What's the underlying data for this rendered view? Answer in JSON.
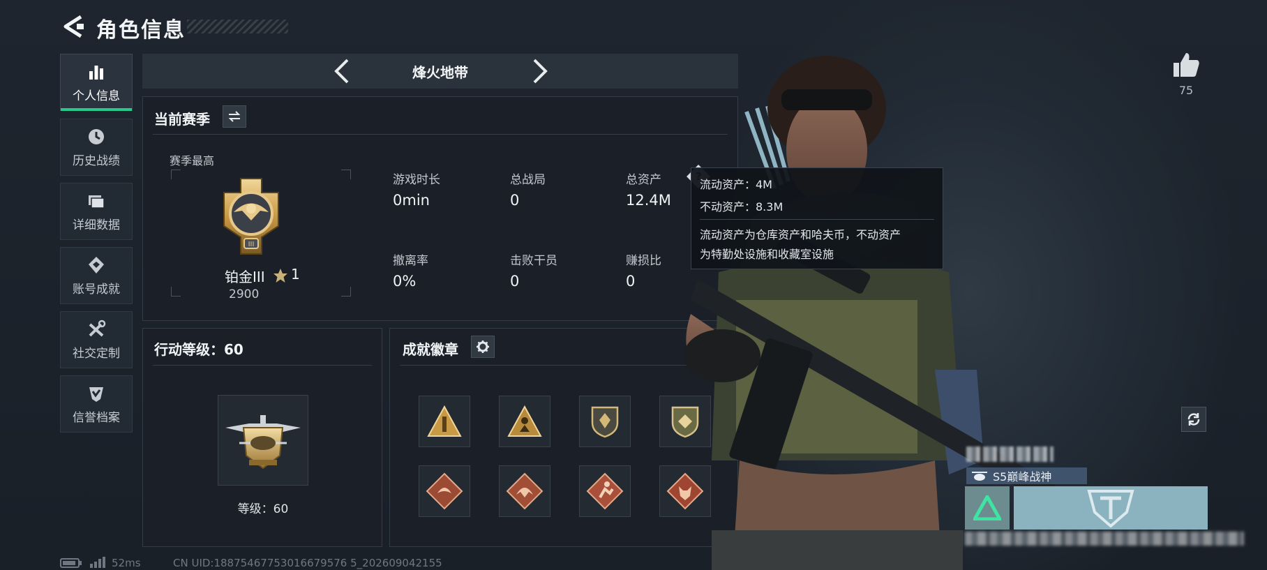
{
  "header": {
    "title": "角色信息"
  },
  "nav": [
    {
      "label": "个人信息",
      "icon": "bar-chart-icon",
      "active": true
    },
    {
      "label": "历史战绩",
      "icon": "clock-icon",
      "active": false
    },
    {
      "label": "详细数据",
      "icon": "folder-icon",
      "active": false
    },
    {
      "label": "账号成就",
      "icon": "diamond-badge-icon",
      "active": false
    },
    {
      "label": "社交定制",
      "icon": "tools-icon",
      "active": false
    },
    {
      "label": "信誉档案",
      "icon": "shield-check-icon",
      "active": false
    }
  ],
  "mode": {
    "label": "烽火地带"
  },
  "season": {
    "title": "当前赛季",
    "best_label": "赛季最高",
    "rank_name": "铂金III",
    "rank_stars": "1",
    "rank_score": "2900",
    "stats": [
      {
        "label": "游戏时长",
        "value": "0min"
      },
      {
        "label": "总战局",
        "value": "0"
      },
      {
        "label": "总资产",
        "value": "12.4M"
      },
      {
        "label": "撤离率",
        "value": "0%"
      },
      {
        "label": "击败干员",
        "value": "0"
      },
      {
        "label": "赚损比",
        "value": "0"
      }
    ]
  },
  "tooltip": {
    "line1": "流动资产：4M",
    "line2": "不动资产：8.3M",
    "desc1": "流动资产为仓库资产和哈夫币，不动资产",
    "desc2": "为特勤处设施和收藏室设施"
  },
  "level": {
    "title": "行动等级：60",
    "caption": "等级：60"
  },
  "badges": {
    "title": "成就徽章",
    "items": [
      "triangle-gold-badge",
      "triangle-figure-badge",
      "shield-crest-badge",
      "shield-green-badge",
      "dragon-badge",
      "dragon-badge-2",
      "runner-badge",
      "wolf-badge"
    ]
  },
  "footer": {
    "ping": "52ms",
    "uid": "CN UID:18875467753016679576 5_202609042155"
  },
  "right": {
    "likes": "75",
    "player_title": "S5巅峰战神"
  },
  "colors": {
    "accent_green": "#27c98d",
    "panel_bg": "#1a2028"
  }
}
